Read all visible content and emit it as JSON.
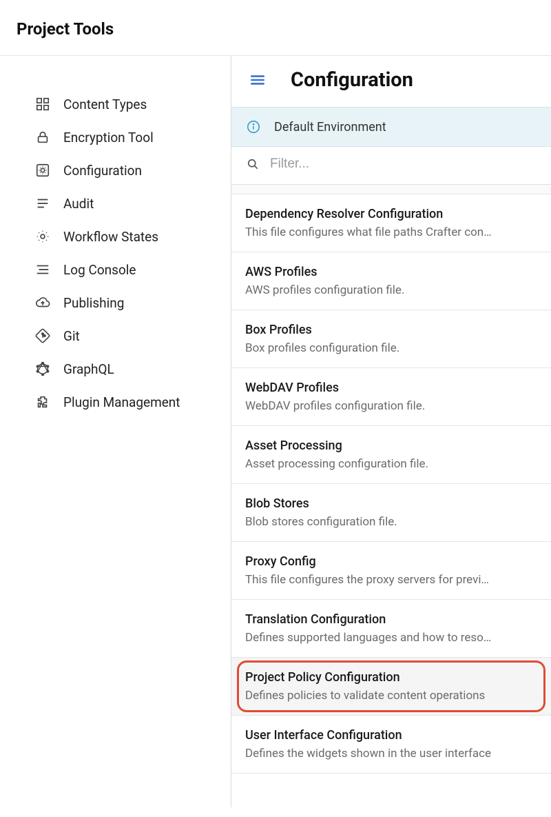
{
  "header": {
    "title": "Project Tools"
  },
  "sidebar": {
    "items": [
      {
        "label": "Content Types",
        "icon": "content-types-icon"
      },
      {
        "label": "Encryption Tool",
        "icon": "lock-icon"
      },
      {
        "label": "Configuration",
        "icon": "gear-box-icon"
      },
      {
        "label": "Audit",
        "icon": "list-icon"
      },
      {
        "label": "Workflow States",
        "icon": "gear-icon"
      },
      {
        "label": "Log Console",
        "icon": "log-icon"
      },
      {
        "label": "Publishing",
        "icon": "cloud-upload-icon"
      },
      {
        "label": "Git",
        "icon": "git-icon"
      },
      {
        "label": "GraphQL",
        "icon": "graphql-icon"
      },
      {
        "label": "Plugin Management",
        "icon": "plugin-icon"
      }
    ]
  },
  "main": {
    "title": "Configuration",
    "environment_label": "Default Environment",
    "filter_placeholder": "Filter...",
    "items": [
      {
        "title": "Dependency Resolver Configuration",
        "desc": "This file configures what file paths Crafter con…"
      },
      {
        "title": "AWS Profiles",
        "desc": "AWS profiles configuration file."
      },
      {
        "title": "Box Profiles",
        "desc": "Box profiles configuration file."
      },
      {
        "title": "WebDAV Profiles",
        "desc": "WebDAV profiles configuration file."
      },
      {
        "title": "Asset Processing",
        "desc": "Asset processing configuration file."
      },
      {
        "title": "Blob Stores",
        "desc": "Blob stores configuration file."
      },
      {
        "title": "Proxy Config",
        "desc": "This file configures the proxy servers for previ…"
      },
      {
        "title": "Translation Configuration",
        "desc": "Defines supported languages and how to reso…"
      },
      {
        "title": "Project Policy Configuration",
        "desc": "Defines policies to validate content operations",
        "highlighted": true
      },
      {
        "title": "User Interface Configuration",
        "desc": "Defines the widgets shown in the user interface"
      }
    ]
  }
}
